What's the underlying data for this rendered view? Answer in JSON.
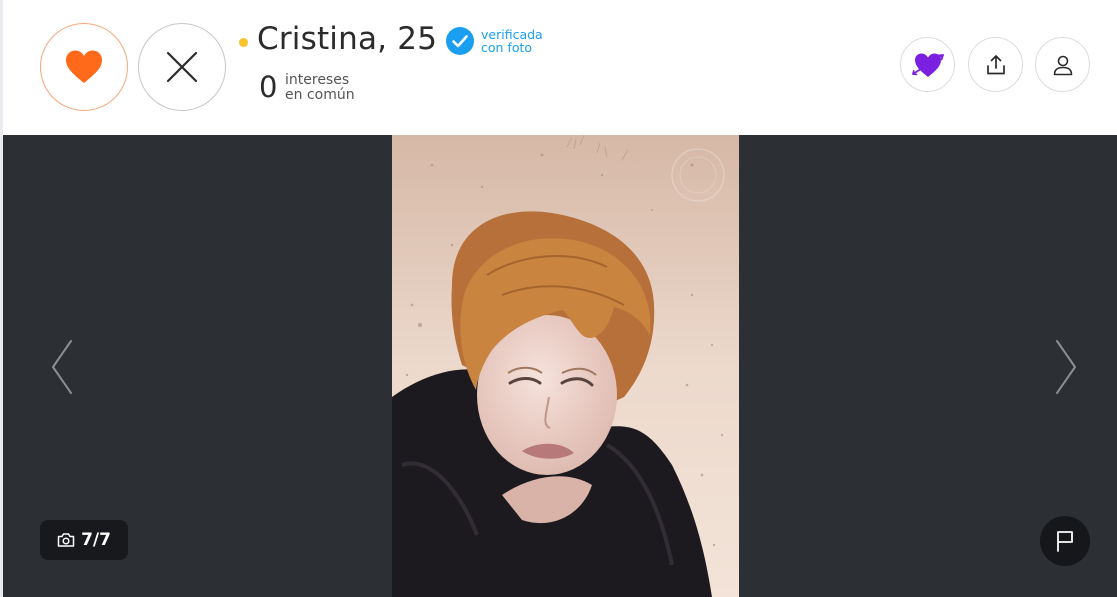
{
  "colors": {
    "accent_orange": "#ff6a1a",
    "online_yellow": "#f7c22c",
    "verified_blue": "#1a9ff0",
    "crush_purple": "#7b1fe0",
    "gallery_background": "#2c2f33"
  },
  "profile": {
    "name_age": "Cristina, 25",
    "status": "online",
    "verified_line1": "verificada",
    "verified_line2": "con foto"
  },
  "common_interests": {
    "count": "0",
    "label_line1": "intereses",
    "label_line2": "en común"
  },
  "actions": {
    "like_icon": "heart-icon",
    "dislike_icon": "close-icon",
    "crush_icon": "heart-arrow-icon",
    "share_icon": "share-icon",
    "profile_icon": "user-icon"
  },
  "gallery": {
    "counter": "7/7",
    "current_photo": 7,
    "total_photos": 7,
    "prev_icon": "chevron-left-icon",
    "next_icon": "chevron-right-icon",
    "report_icon": "flag-icon",
    "camera_icon": "camera-icon"
  }
}
